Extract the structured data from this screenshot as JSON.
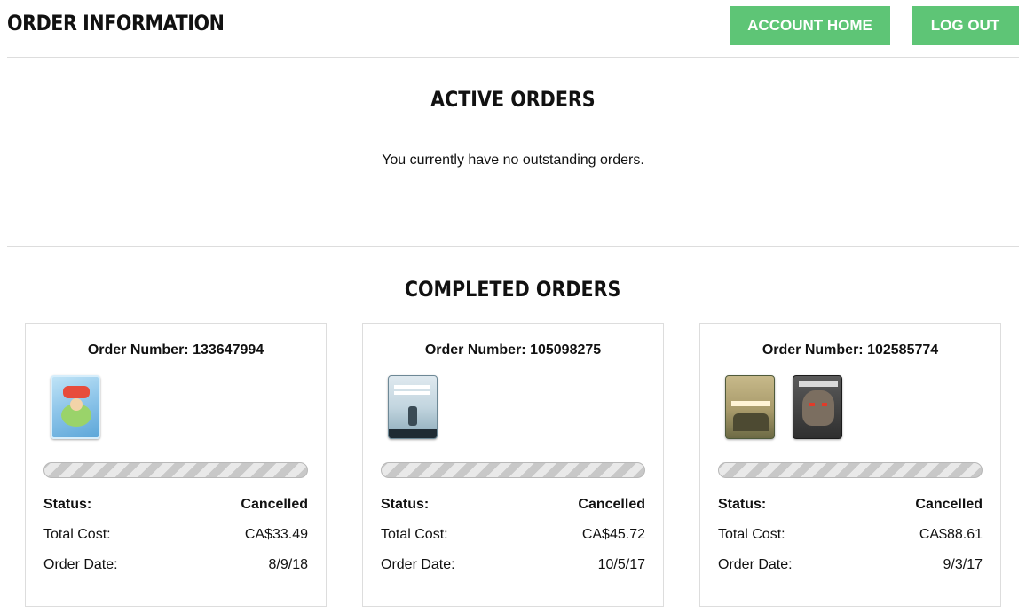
{
  "header": {
    "title": "ORDER INFORMATION",
    "account_home_label": "ACCOUNT HOME",
    "log_out_label": "LOG OUT"
  },
  "active_orders": {
    "title": "ACTIVE ORDERS",
    "empty_message": "You currently have no outstanding orders."
  },
  "completed_orders": {
    "title": "COMPLETED ORDERS",
    "status_label": "Status:",
    "total_cost_label": "Total Cost:",
    "order_date_label": "Order Date:",
    "orders": [
      {
        "order_number_label": "Order Number: 133647994",
        "status": "Cancelled",
        "total_cost": "CA$33.49",
        "order_date": "8/9/18",
        "progress": 0,
        "thumbnails": [
          "meet-the-robinsons-cover"
        ]
      },
      {
        "order_number_label": "Order Number: 105098275",
        "status": "Cancelled",
        "total_cost": "CA$45.72",
        "order_date": "10/5/17",
        "progress": 0,
        "thumbnails": [
          "blade-runner-2049-cover"
        ]
      },
      {
        "order_number_label": "Order Number: 102585774",
        "status": "Cancelled",
        "total_cost": "CA$88.61",
        "order_date": "9/3/17",
        "progress": 0,
        "thumbnails": [
          "o-brother-cover",
          "planet-of-the-apes-cover"
        ]
      }
    ]
  },
  "colors": {
    "button_bg": "#5ec576",
    "button_text": "#ffffff",
    "divider": "#dddddd",
    "progress_stripe_dark": "#c8c8c8",
    "progress_stripe_light": "#e9e9e9"
  }
}
